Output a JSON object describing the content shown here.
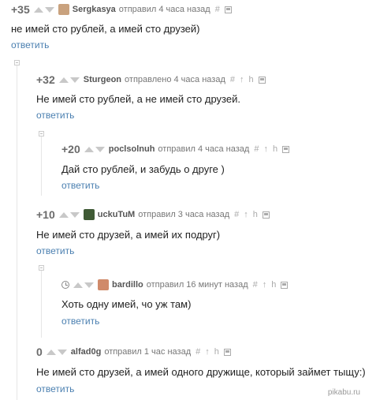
{
  "reply_label": "ответить",
  "watermark": "pikabu.ru",
  "comments": [
    {
      "rating": "+35",
      "author": "Sergkasya",
      "meta": "отправил 4 часа назад",
      "text": "не имей сто рублей, а имей сто друзей)"
    },
    {
      "rating": "+32",
      "author": "Sturgeon",
      "meta": "отправлено 4 часа назад",
      "text": "Не имей сто рублей, а не имей сто друзей."
    },
    {
      "rating": "+20",
      "author": "poclsolnuh",
      "meta": "отправил 4 часа назад",
      "text": "Дай сто рублей, и забудь о друге )"
    },
    {
      "rating": "+10",
      "author": "uckuTuM",
      "meta": "отправил 3 часа назад",
      "text": "Не имей сто друзей, а имей их подруг)"
    },
    {
      "rating": "",
      "author": "bardillo",
      "meta": "отправил 16 минут назад",
      "text": "Хоть одну имей, чо уж там)"
    },
    {
      "rating": "0",
      "author": "alfad0g",
      "meta": "отправил 1 час назад",
      "text": "Не имей сто друзей, а имей одного дружище, который займет тыщу:)"
    }
  ],
  "icons": {
    "hash": "#",
    "up": "↑",
    "parent": "h"
  }
}
